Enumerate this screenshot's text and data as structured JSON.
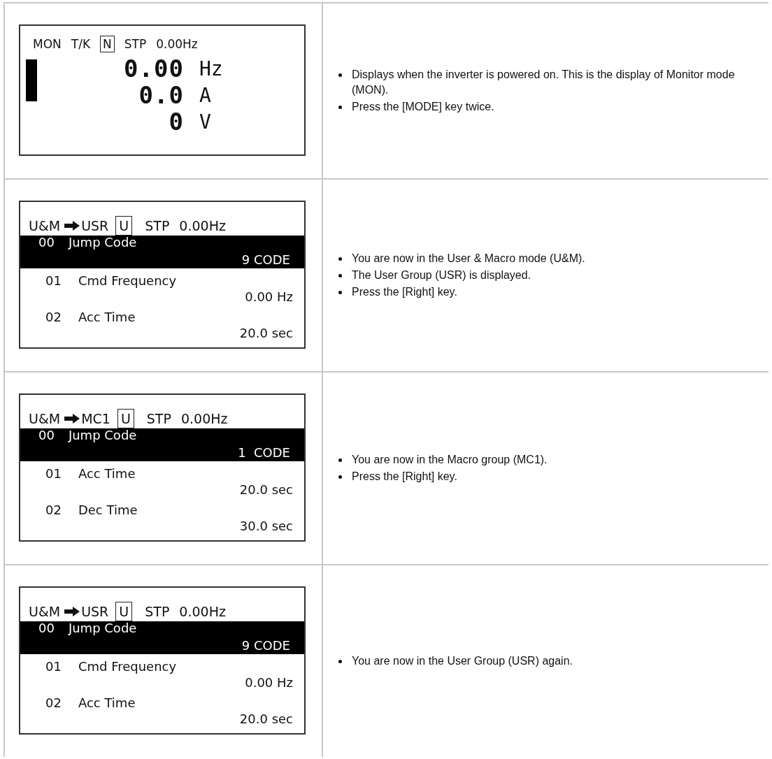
{
  "steps": [
    {
      "display": {
        "kind": "monitor",
        "header": {
          "mode": "MON",
          "group": "T/K",
          "indicator": "N",
          "state": "STP",
          "frequency": "0.00Hz"
        },
        "readings": [
          {
            "value": "0.00",
            "unit": "Hz"
          },
          {
            "value": "0.0",
            "unit": "A"
          },
          {
            "value": "0",
            "unit": "V"
          }
        ]
      },
      "notes": [
        "Displays when the inverter is powered on. This is the display of Monitor mode (MON).",
        "Press the [MODE] key twice."
      ]
    },
    {
      "display": {
        "kind": "parameter",
        "header": {
          "mode": "U&M",
          "group": "USR",
          "indicator": "U",
          "state": "STP",
          "frequency": "0.00Hz"
        },
        "highlighted": {
          "code": "00",
          "name": "Jump Code",
          "value": "9 CODE"
        },
        "rows": [
          {
            "code": "01",
            "name": "Cmd Frequency",
            "value": "0.00 Hz"
          },
          {
            "code": "02",
            "name": "Acc Time",
            "value": "20.0 sec"
          }
        ]
      },
      "notes": [
        "You are now in the User & Macro mode (U&M).",
        "The User Group (USR) is displayed.",
        "Press the [Right] key."
      ]
    },
    {
      "display": {
        "kind": "parameter",
        "header": {
          "mode": "U&M",
          "group": "MC1",
          "indicator": "U",
          "state": "STP",
          "frequency": "0.00Hz"
        },
        "highlighted": {
          "code": "00",
          "name": "Jump Code",
          "value": "1  CODE"
        },
        "rows": [
          {
            "code": "01",
            "name": "Acc Time",
            "value": "20.0 sec"
          },
          {
            "code": "02",
            "name": "Dec Time",
            "value": "30.0 sec"
          }
        ]
      },
      "notes": [
        "You are now in the Macro group (MC1).",
        "Press the [Right] key."
      ]
    },
    {
      "display": {
        "kind": "parameter",
        "header": {
          "mode": "U&M",
          "group": "USR",
          "indicator": "U",
          "state": "STP",
          "frequency": "0.00Hz"
        },
        "highlighted": {
          "code": "00",
          "name": "Jump Code",
          "value": "9 CODE"
        },
        "rows": [
          {
            "code": "01",
            "name": "Cmd Frequency",
            "value": "0.00 Hz"
          },
          {
            "code": "02",
            "name": "Acc Time",
            "value": "20.0 sec"
          }
        ]
      },
      "notes": [
        "You are now in the User Group (USR) again."
      ]
    }
  ]
}
